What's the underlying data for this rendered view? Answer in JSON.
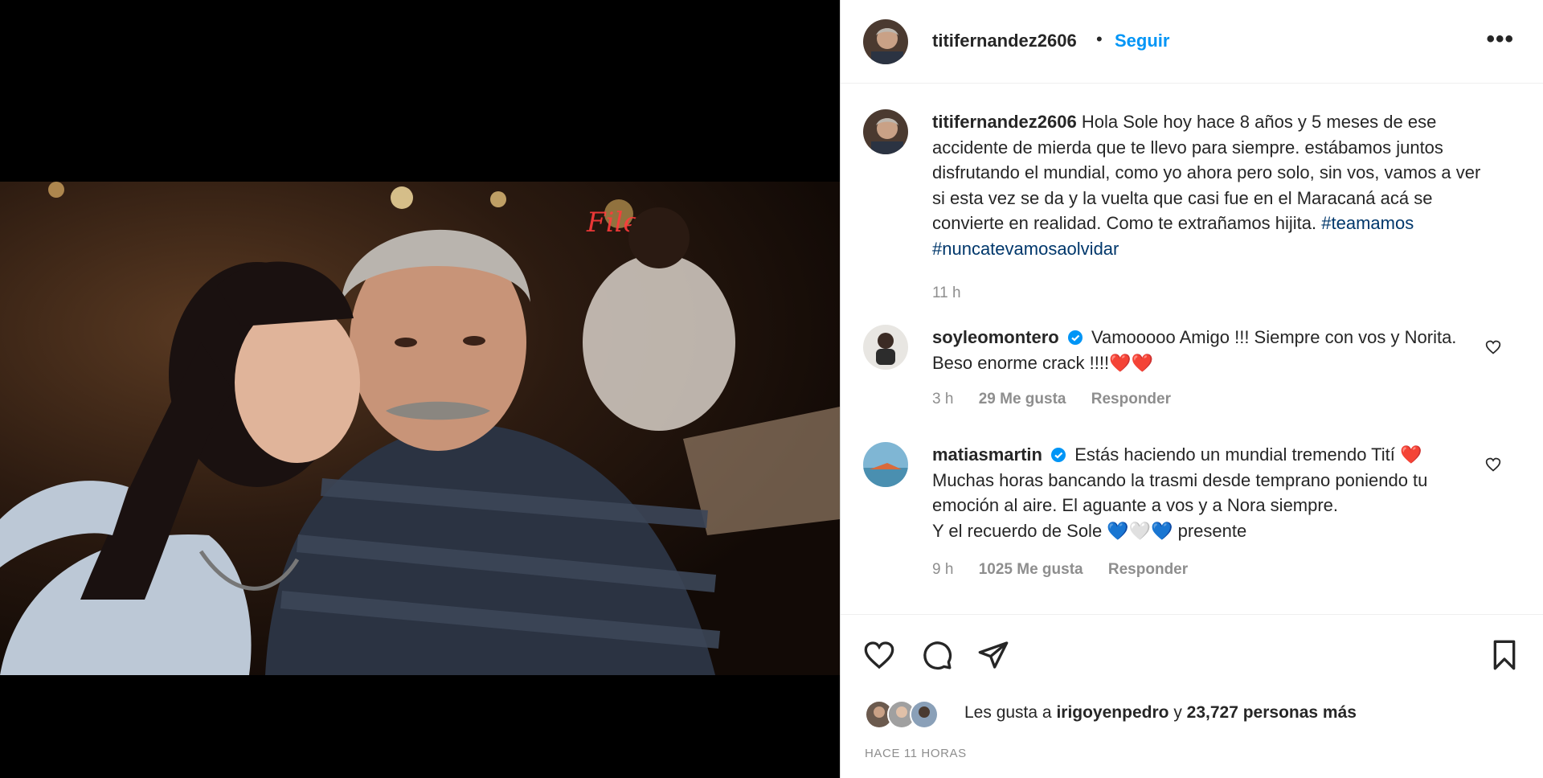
{
  "post": {
    "username": "titifernandez2606",
    "separator": "•",
    "follow_label": "Seguir",
    "more_label": "•••"
  },
  "caption": {
    "username": "titifernandez2606",
    "text": "Hola Sole hoy hace 8 años y 5 meses de ese accidente de mierda que te llevo para siempre. estábamos juntos disfrutando el mundial, como yo ahora pero solo, sin vos, vamos a ver si esta vez se da y la vuelta que casi fue en el Maracaná acá se convierte en realidad. Como te extrañamos hijita.",
    "hashtags": [
      "#teamamos",
      "#nuncatevamosaolvidar"
    ],
    "time": "11 h"
  },
  "comments": [
    {
      "username": "soyleomontero",
      "verified": true,
      "text": "Vamooooo Amigo !!! Siempre con vos y Norita. Beso enorme crack !!!!",
      "emojis": "❤️❤️",
      "time": "3 h",
      "likes": "29 Me gusta",
      "reply_label": "Responder"
    },
    {
      "username": "matiasmartin",
      "verified": true,
      "line1": "Estás haciendo un mundial tremendo Tití",
      "line1_emoji": "❤️",
      "line2": "Muchas horas bancando la trasmi desde temprano poniendo tu emoción al aire. El aguante a vos y a Nora siempre.",
      "line3_prefix": "Y el recuerdo de Sole",
      "line3_emojis": "💙🤍💙",
      "line3_suffix": "presente",
      "time": "9 h",
      "likes": "1025 Me gusta",
      "reply_label": "Responder"
    }
  ],
  "likes": {
    "prefix": "Les gusta a",
    "user": "irigoyenpedro",
    "conjunction": "y",
    "count": "23,727 personas más"
  },
  "timestamp": "HACE 11 HORAS",
  "colors": {
    "accent": "#0095f6",
    "hashtag": "#00376b",
    "secondary_text": "#8e8e8e",
    "heart_red": "#ed4956",
    "verified_blue": "#0095f6"
  },
  "icons": [
    "heart-icon",
    "comment-icon",
    "share-icon",
    "bookmark-icon",
    "more-options-icon",
    "verified-icon"
  ]
}
